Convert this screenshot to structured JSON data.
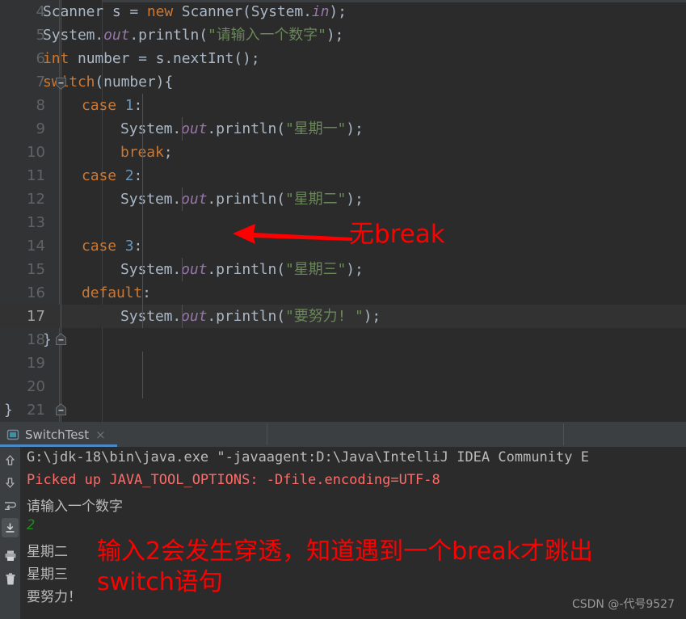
{
  "editor": {
    "first_visible_line": 4,
    "current_line": 17,
    "lines": [
      {
        "no": 4,
        "indent": 0,
        "tokens": [
          {
            "t": "Scanner s = ",
            "c": "pl"
          },
          {
            "t": "new",
            "c": "kw"
          },
          {
            "t": " Scanner(System.",
            "c": "pl"
          },
          {
            "t": "in",
            "c": "fld"
          },
          {
            "t": ");",
            "c": "pl"
          }
        ]
      },
      {
        "no": 5,
        "indent": 0,
        "tokens": [
          {
            "t": "System.",
            "c": "pl"
          },
          {
            "t": "out",
            "c": "fld"
          },
          {
            "t": ".println(",
            "c": "pl"
          },
          {
            "t": "\"请输入一个数字\"",
            "c": "str"
          },
          {
            "t": ");",
            "c": "pl"
          }
        ]
      },
      {
        "no": 6,
        "indent": 0,
        "tokens": [
          {
            "t": "int",
            "c": "kw"
          },
          {
            "t": " number = s.nextInt();",
            "c": "pl"
          }
        ]
      },
      {
        "no": 7,
        "indent": 0,
        "tokens": [
          {
            "t": "switch",
            "c": "kw"
          },
          {
            "t": "(number){",
            "c": "pl"
          }
        ]
      },
      {
        "no": 8,
        "indent": 1,
        "tokens": [
          {
            "t": "case",
            "c": "kw"
          },
          {
            "t": " ",
            "c": "pl"
          },
          {
            "t": "1",
            "c": "num"
          },
          {
            "t": ":",
            "c": "pl"
          }
        ]
      },
      {
        "no": 9,
        "indent": 2,
        "tokens": [
          {
            "t": "System.",
            "c": "pl"
          },
          {
            "t": "out",
            "c": "fld"
          },
          {
            "t": ".println(",
            "c": "pl"
          },
          {
            "t": "\"星期一\"",
            "c": "str"
          },
          {
            "t": ");",
            "c": "pl"
          }
        ]
      },
      {
        "no": 10,
        "indent": 2,
        "tokens": [
          {
            "t": "break",
            "c": "kw"
          },
          {
            "t": ";",
            "c": "pl"
          }
        ]
      },
      {
        "no": 11,
        "indent": 1,
        "tokens": [
          {
            "t": "case",
            "c": "kw"
          },
          {
            "t": " ",
            "c": "pl"
          },
          {
            "t": "2",
            "c": "num"
          },
          {
            "t": ":",
            "c": "pl"
          }
        ]
      },
      {
        "no": 12,
        "indent": 2,
        "tokens": [
          {
            "t": "System.",
            "c": "pl"
          },
          {
            "t": "out",
            "c": "fld"
          },
          {
            "t": ".println(",
            "c": "pl"
          },
          {
            "t": "\"星期二\"",
            "c": "str"
          },
          {
            "t": ");",
            "c": "pl"
          }
        ]
      },
      {
        "no": 13,
        "indent": 0,
        "tokens": []
      },
      {
        "no": 14,
        "indent": 1,
        "tokens": [
          {
            "t": "case",
            "c": "kw"
          },
          {
            "t": " ",
            "c": "pl"
          },
          {
            "t": "3",
            "c": "num"
          },
          {
            "t": ":",
            "c": "pl"
          }
        ]
      },
      {
        "no": 15,
        "indent": 2,
        "tokens": [
          {
            "t": "System.",
            "c": "pl"
          },
          {
            "t": "out",
            "c": "fld"
          },
          {
            "t": ".println(",
            "c": "pl"
          },
          {
            "t": "\"星期三\"",
            "c": "str"
          },
          {
            "t": ");",
            "c": "pl"
          }
        ]
      },
      {
        "no": 16,
        "indent": 1,
        "tokens": [
          {
            "t": "default",
            "c": "kw"
          },
          {
            "t": ":",
            "c": "pl"
          }
        ]
      },
      {
        "no": 17,
        "indent": 2,
        "tokens": [
          {
            "t": "System.",
            "c": "pl"
          },
          {
            "t": "out",
            "c": "fld"
          },
          {
            "t": ".println(",
            "c": "pl"
          },
          {
            "t": "\"要努力! \"",
            "c": "str"
          },
          {
            "t": ");",
            "c": "pl"
          }
        ]
      },
      {
        "no": 18,
        "indent": 0,
        "tokens": [
          {
            "t": "}",
            "c": "pl"
          }
        ]
      },
      {
        "no": 19,
        "indent": 0,
        "tokens": []
      },
      {
        "no": 20,
        "indent": 0,
        "tokens": []
      },
      {
        "no": 21,
        "indent": -1,
        "tokens": [
          {
            "t": "}",
            "c": "pl"
          }
        ]
      }
    ],
    "fold_markers": [
      {
        "line": 7,
        "type": "fold-collapse-icon"
      },
      {
        "line": 18,
        "type": "fold-end-icon"
      },
      {
        "line": 21,
        "type": "fold-end-icon"
      }
    ],
    "annotation": {
      "arrow": "left-arrow-annotation",
      "text": "无break",
      "color": "#fe0000"
    }
  },
  "console": {
    "tab": {
      "label": "SwitchTest",
      "icon": "run-configuration-icon",
      "close": "×"
    },
    "sidebar_buttons": [
      {
        "name": "up-arrow-icon",
        "active": false
      },
      {
        "name": "down-arrow-icon",
        "active": false
      },
      {
        "name": "soft-wrap-icon",
        "active": false
      },
      {
        "name": "scroll-to-end-icon",
        "active": true
      },
      {
        "name": "print-icon",
        "active": false
      },
      {
        "name": "trash-icon",
        "active": false
      }
    ],
    "output_lines": [
      {
        "text": "G:\\jdk-18\\bin\\java.exe \"-javaagent:D:\\Java\\IntelliJ IDEA Community E",
        "kind": "normal"
      },
      {
        "text": "Picked up JAVA_TOOL_OPTIONS: -Dfile.encoding=UTF-8",
        "kind": "error"
      },
      {
        "text": "请输入一个数字",
        "kind": "cjk"
      },
      {
        "text": "2",
        "kind": "input"
      },
      {
        "text": "星期二",
        "kind": "cjk"
      },
      {
        "text": "星期三",
        "kind": "cjk"
      },
      {
        "text": "要努力！",
        "kind": "cjk"
      }
    ],
    "annotation_line1": "输入2会发生穿透，知道遇到一个break才跳出",
    "annotation_line2": "switch语句",
    "annotation_color": "#fe0000"
  },
  "watermark": "CSDN @-代号9527",
  "colors": {
    "editor_bg": "#2b2b2b",
    "gutter_bg": "#313335",
    "current_line_bg": "#323232",
    "text": "#a9b7c6",
    "keyword": "#cc7832",
    "string": "#6a8759",
    "number": "#6897bb",
    "field": "#9876aa",
    "line_number": "#606366",
    "tabbar_bg": "#3c3f41",
    "tab_underline": "#4a88c7",
    "console_error": "#ff6b68",
    "console_input": "#1a8f1a",
    "annotation_red": "#fe0000"
  }
}
